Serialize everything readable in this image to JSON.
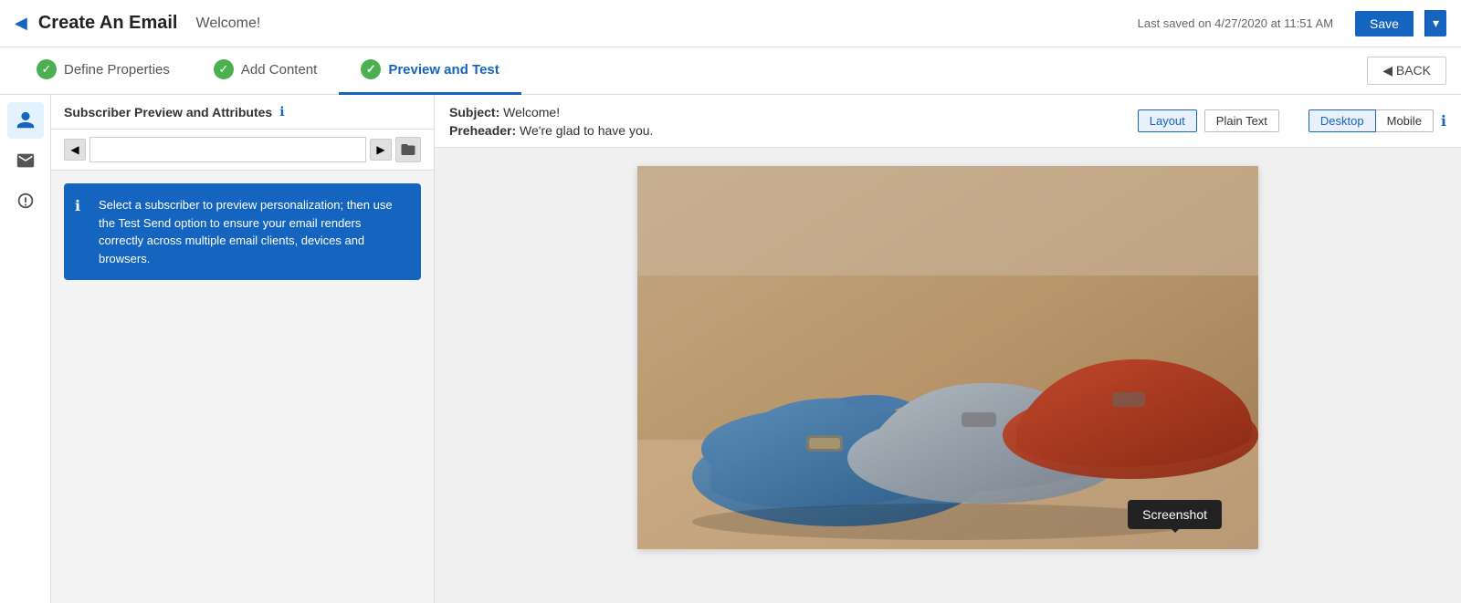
{
  "header": {
    "back_arrow": "◀",
    "title": "Create An Email",
    "subtitle": "Welcome!",
    "saved_text": "Last saved on 4/27/2020 at 11:51 AM",
    "save_label": "Save",
    "save_dropdown_icon": "▾"
  },
  "step_nav": {
    "steps": [
      {
        "id": "define",
        "label": "Define Properties",
        "icon": "check",
        "active": false
      },
      {
        "id": "content",
        "label": "Add Content",
        "icon": "check",
        "active": false
      },
      {
        "id": "preview",
        "label": "Preview and Test",
        "icon": "check",
        "active": true
      }
    ],
    "back_label": "◀ BACK"
  },
  "left_panel": {
    "title": "Subscriber Preview and Attributes",
    "info_icon": "ℹ",
    "nav_prev": "◀",
    "nav_next": "▶",
    "subscriber_placeholder": "",
    "folder_icon": "📁",
    "info_box": {
      "icon": "ℹ",
      "text": "Select a subscriber to preview personalization; then use the Test Send option to ensure your email renders correctly across multiple email clients, devices and browsers."
    }
  },
  "right_panel": {
    "subject_label": "Subject:",
    "subject_value": "Welcome!",
    "preheader_label": "Preheader:",
    "preheader_value": "We're glad to have you.",
    "view_buttons": {
      "layout_label": "Layout",
      "plain_text_label": "Plain Text",
      "desktop_label": "Desktop",
      "mobile_label": "Mobile",
      "info_icon": "ℹ"
    },
    "screenshot_label": "Screenshot"
  },
  "colors": {
    "primary": "#1565c0",
    "active_border": "#1565c0",
    "success": "#4caf50"
  }
}
